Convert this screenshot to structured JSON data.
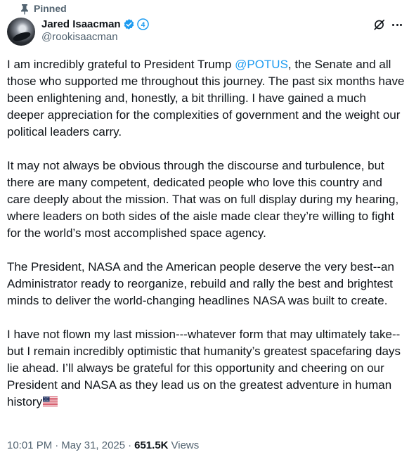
{
  "pinned": {
    "label": "Pinned",
    "icon": "pin-icon"
  },
  "author": {
    "name": "Jared Isaacman",
    "handle": "@rookisaacman",
    "verified_color": "#1d9bf0",
    "affiliate_badge": "4"
  },
  "actions": {
    "grok_icon": "grok-icon",
    "more_icon": "more-icon"
  },
  "tweet": {
    "p1_before": "I am incredibly grateful to President Trump ",
    "p1_mention": "@POTUS",
    "p1_after": ", the Senate and all those who supported me throughout this journey. The past six months have been enlightening and, honestly, a bit thrilling. I have gained a much deeper appreciation for the complexities of government and the weight our political leaders carry.",
    "p2": "It may not always be obvious through the discourse and turbulence, but there are many competent, dedicated people who love this country and care deeply about the mission. That was on full display during my hearing, where leaders on both sides of the aisle made clear they’re willing to fight for the world’s most accomplished space agency.",
    "p3": "The President, NASA and the American people deserve the very best--an Administrator ready to reorganize, rebuild and rally the best and brightest minds to deliver the world-changing headlines NASA was built to create.",
    "p4": "I have not flown my last mission---whatever form that may ultimately take--but I remain incredibly optimistic that humanity’s greatest spacefaring days lie ahead. I’ll always be grateful for this opportunity and cheering on our President and NASA as they lead us on the greatest adventure in human history",
    "mention_color": "#1d9bf0"
  },
  "meta": {
    "time": "10:01 PM",
    "separator": "·",
    "date": "May 31, 2025",
    "views_count": "651.5K",
    "views_label": "Views"
  }
}
